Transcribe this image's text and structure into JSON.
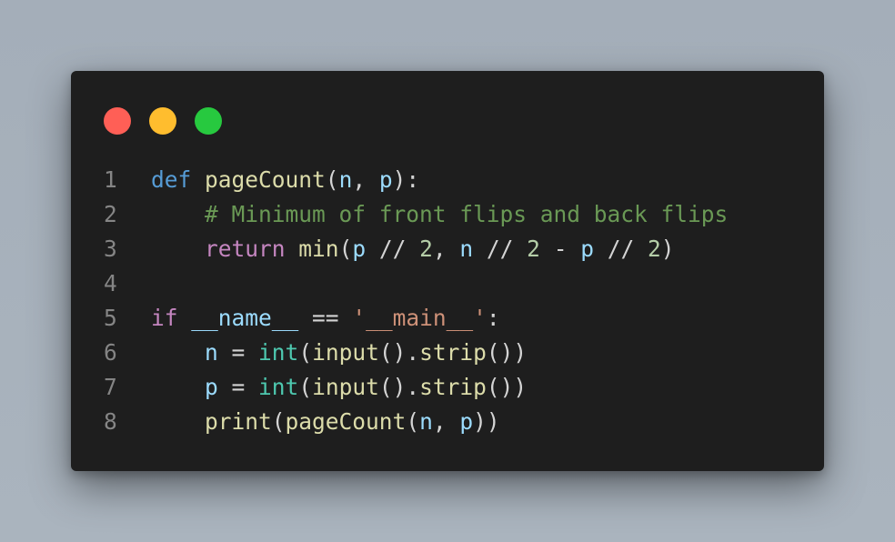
{
  "window": {
    "controls": [
      "close",
      "minimize",
      "maximize"
    ]
  },
  "code": {
    "language": "python",
    "lines": [
      {
        "number": "1",
        "tokens": [
          {
            "t": "def",
            "k": "kw-def"
          },
          {
            "t": " ",
            "k": "plain"
          },
          {
            "t": "pageCount",
            "k": "fn"
          },
          {
            "t": "(",
            "k": "plain"
          },
          {
            "t": "n",
            "k": "param"
          },
          {
            "t": ", ",
            "k": "plain"
          },
          {
            "t": "p",
            "k": "param"
          },
          {
            "t": "):",
            "k": "plain"
          }
        ]
      },
      {
        "number": "2",
        "tokens": [
          {
            "t": "    ",
            "k": "plain"
          },
          {
            "t": "# Minimum of front flips and back flips",
            "k": "cmt"
          }
        ]
      },
      {
        "number": "3",
        "tokens": [
          {
            "t": "    ",
            "k": "plain"
          },
          {
            "t": "return",
            "k": "kw-ctrl"
          },
          {
            "t": " ",
            "k": "plain"
          },
          {
            "t": "min",
            "k": "fn"
          },
          {
            "t": "(",
            "k": "plain"
          },
          {
            "t": "p",
            "k": "param"
          },
          {
            "t": " // ",
            "k": "plain"
          },
          {
            "t": "2",
            "k": "num"
          },
          {
            "t": ", ",
            "k": "plain"
          },
          {
            "t": "n",
            "k": "param"
          },
          {
            "t": " // ",
            "k": "plain"
          },
          {
            "t": "2",
            "k": "num"
          },
          {
            "t": " - ",
            "k": "plain"
          },
          {
            "t": "p",
            "k": "param"
          },
          {
            "t": " // ",
            "k": "plain"
          },
          {
            "t": "2",
            "k": "num"
          },
          {
            "t": ")",
            "k": "plain"
          }
        ]
      },
      {
        "number": "4",
        "tokens": []
      },
      {
        "number": "5",
        "tokens": [
          {
            "t": "if",
            "k": "kw-ctrl"
          },
          {
            "t": " ",
            "k": "plain"
          },
          {
            "t": "__name__",
            "k": "param"
          },
          {
            "t": " == ",
            "k": "plain"
          },
          {
            "t": "'__main__'",
            "k": "str"
          },
          {
            "t": ":",
            "k": "plain"
          }
        ]
      },
      {
        "number": "6",
        "tokens": [
          {
            "t": "    ",
            "k": "plain"
          },
          {
            "t": "n",
            "k": "param"
          },
          {
            "t": " = ",
            "k": "plain"
          },
          {
            "t": "int",
            "k": "cls"
          },
          {
            "t": "(",
            "k": "plain"
          },
          {
            "t": "input",
            "k": "fn"
          },
          {
            "t": "().",
            "k": "plain"
          },
          {
            "t": "strip",
            "k": "fn"
          },
          {
            "t": "())",
            "k": "plain"
          }
        ]
      },
      {
        "number": "7",
        "tokens": [
          {
            "t": "    ",
            "k": "plain"
          },
          {
            "t": "p",
            "k": "param"
          },
          {
            "t": " = ",
            "k": "plain"
          },
          {
            "t": "int",
            "k": "cls"
          },
          {
            "t": "(",
            "k": "plain"
          },
          {
            "t": "input",
            "k": "fn"
          },
          {
            "t": "().",
            "k": "plain"
          },
          {
            "t": "strip",
            "k": "fn"
          },
          {
            "t": "())",
            "k": "plain"
          }
        ]
      },
      {
        "number": "8",
        "tokens": [
          {
            "t": "    ",
            "k": "plain"
          },
          {
            "t": "print",
            "k": "fn"
          },
          {
            "t": "(",
            "k": "plain"
          },
          {
            "t": "pageCount",
            "k": "fn"
          },
          {
            "t": "(",
            "k": "plain"
          },
          {
            "t": "n",
            "k": "param"
          },
          {
            "t": ", ",
            "k": "plain"
          },
          {
            "t": "p",
            "k": "param"
          },
          {
            "t": "))",
            "k": "plain"
          }
        ]
      }
    ]
  },
  "colors": {
    "background": "#a4aeb9",
    "editor_background": "#1e1e1e",
    "close_dot": "#ff5f56",
    "minimize_dot": "#ffbd2e",
    "maximize_dot": "#27c93f",
    "keyword_def": "#569cd6",
    "keyword_control": "#c586c0",
    "function": "#dcdcaa",
    "variable": "#9cdcfe",
    "comment": "#6a9955",
    "number": "#b5cea8",
    "string": "#ce9178",
    "builtin_type": "#4ec9b0",
    "line_number": "#858585",
    "text": "#d4d4d4"
  }
}
